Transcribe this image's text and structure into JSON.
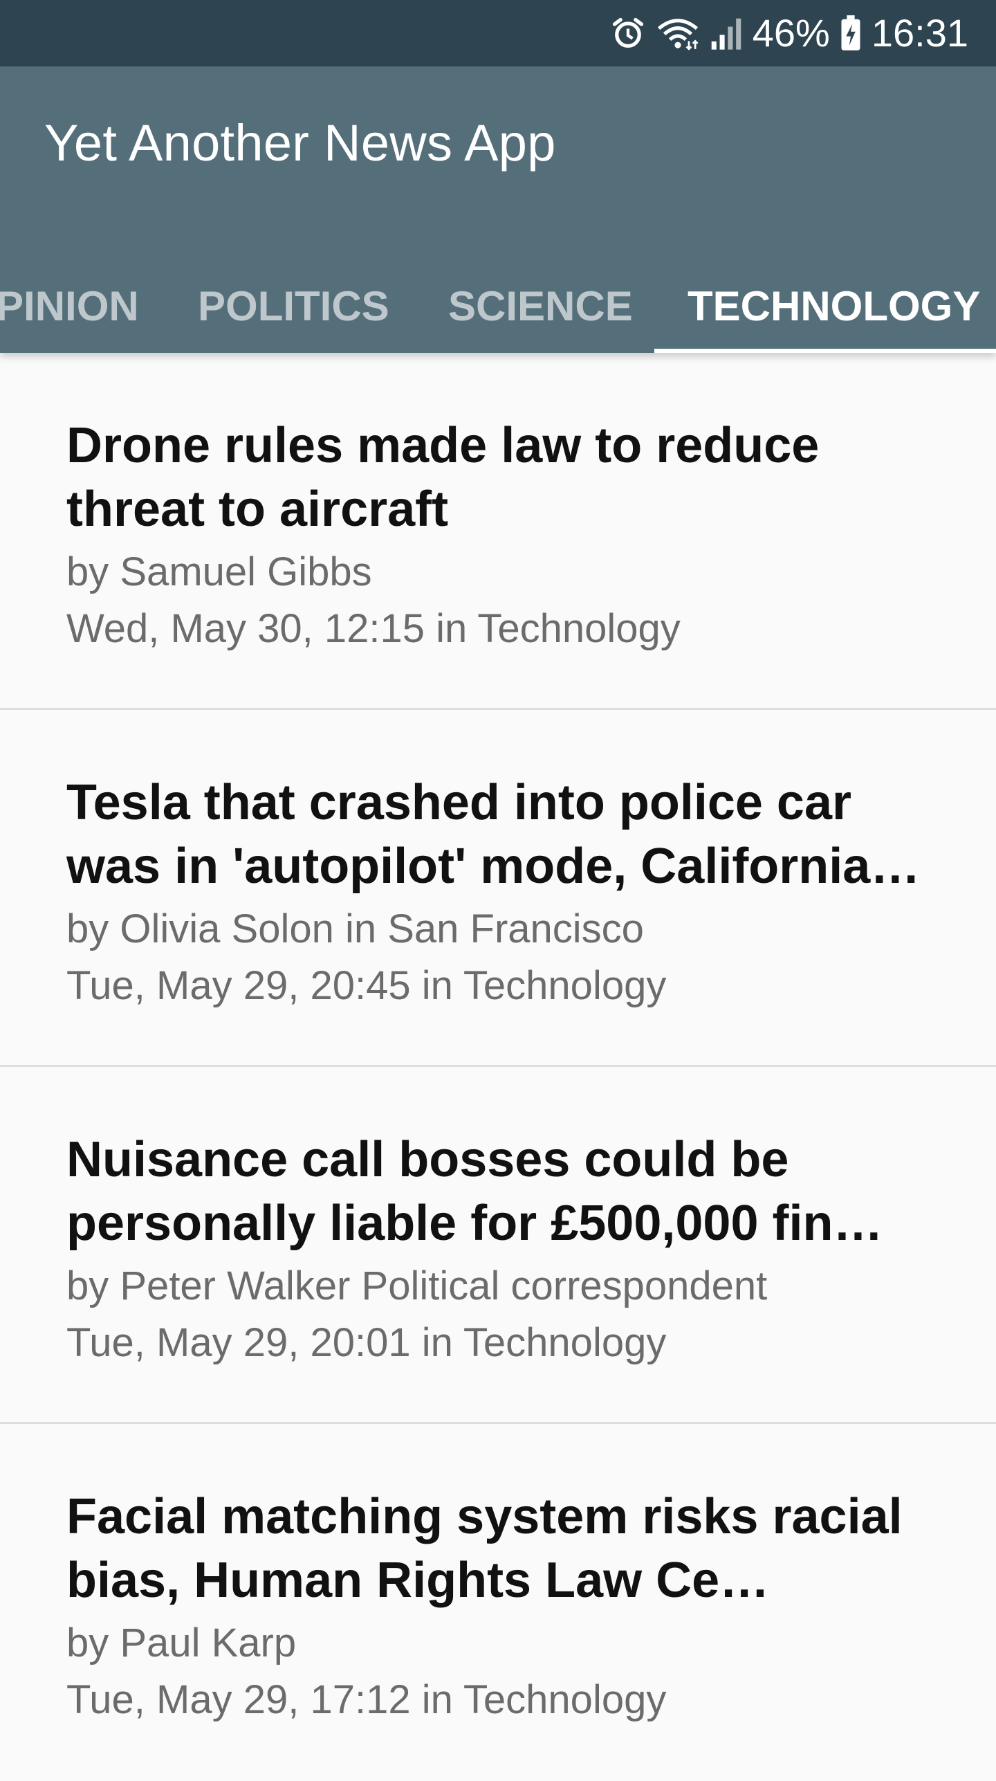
{
  "status_bar": {
    "alarm_icon": "alarm-icon",
    "wifi_icon": "wifi-icon",
    "signal_icon": "signal-icon",
    "battery_percent": "46%",
    "battery_icon": "battery-charging-icon",
    "time": "16:31"
  },
  "app": {
    "title": "Yet Another News App",
    "colors": {
      "status_bar": "#2e4450",
      "app_bar": "#556f7a",
      "background": "#fafafa"
    }
  },
  "tabs": [
    {
      "label": "PINION",
      "active": false
    },
    {
      "label": "POLITICS",
      "active": false
    },
    {
      "label": "SCIENCE",
      "active": false
    },
    {
      "label": "TECHNOLOGY",
      "active": true
    }
  ],
  "articles": [
    {
      "headline": "Drone rules made law to reduce threat to aircraft",
      "byline": "by Samuel Gibbs",
      "dateline": "Wed, May 30, 12:15 in Technology"
    },
    {
      "headline": "Tesla that crashed into police car was in 'autopilot' mode, California…",
      "byline": "by Olivia Solon in San Francisco",
      "dateline": "Tue, May 29, 20:45 in Technology"
    },
    {
      "headline": "Nuisance call bosses could be personally liable for £500,000 fin…",
      "byline": "by Peter Walker Political correspondent",
      "dateline": "Tue, May 29, 20:01 in Technology"
    },
    {
      "headline": "Facial matching system risks racial bias, Human Rights Law Ce…",
      "byline": "by Paul Karp",
      "dateline": "Tue, May 29, 17:12 in Technology"
    }
  ]
}
